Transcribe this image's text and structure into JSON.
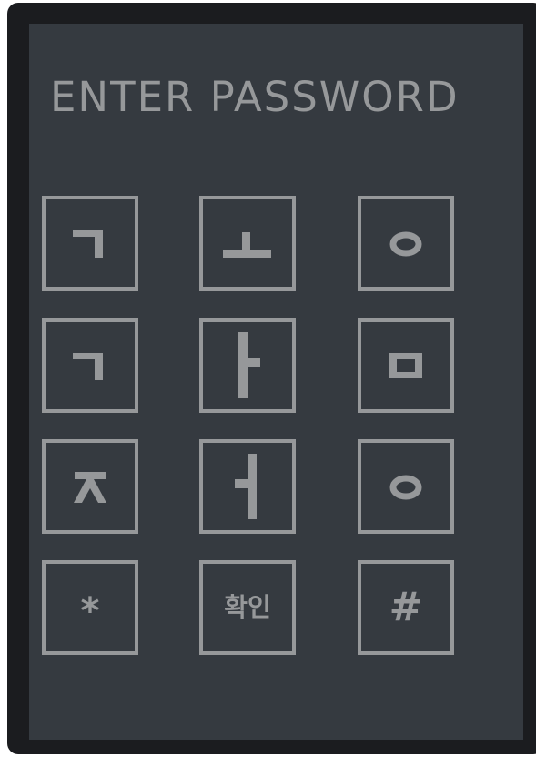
{
  "title": "ENTER PASSWORD",
  "keypad": [
    {
      "id": "key-giyeok-1",
      "glyph": "ㄱ",
      "icon": "giyeok-icon"
    },
    {
      "id": "key-o-vowel",
      "glyph": "ㅗ",
      "icon": "o-vowel-icon"
    },
    {
      "id": "key-ieung-1",
      "glyph": "ㅇ",
      "icon": "ieung-icon"
    },
    {
      "id": "key-giyeok-2",
      "glyph": "ㄱ",
      "icon": "giyeok-icon"
    },
    {
      "id": "key-a-vowel",
      "glyph": "ㅏ",
      "icon": "a-vowel-icon"
    },
    {
      "id": "key-mieum",
      "glyph": "ㅁ",
      "icon": "mieum-icon"
    },
    {
      "id": "key-jieut",
      "glyph": "ㅈ",
      "icon": "jieut-icon"
    },
    {
      "id": "key-eo-vowel",
      "glyph": "ㅓ",
      "icon": "eo-vowel-icon"
    },
    {
      "id": "key-ieung-2",
      "glyph": "ㅇ",
      "icon": "ieung-icon"
    }
  ],
  "bottom_row": {
    "star_label": "*",
    "confirm_label": "확인",
    "hash_label": "#"
  },
  "colors": {
    "device_frame": "#1b1c1f",
    "screen_background": "#353a40",
    "foreground": "#96989a"
  }
}
